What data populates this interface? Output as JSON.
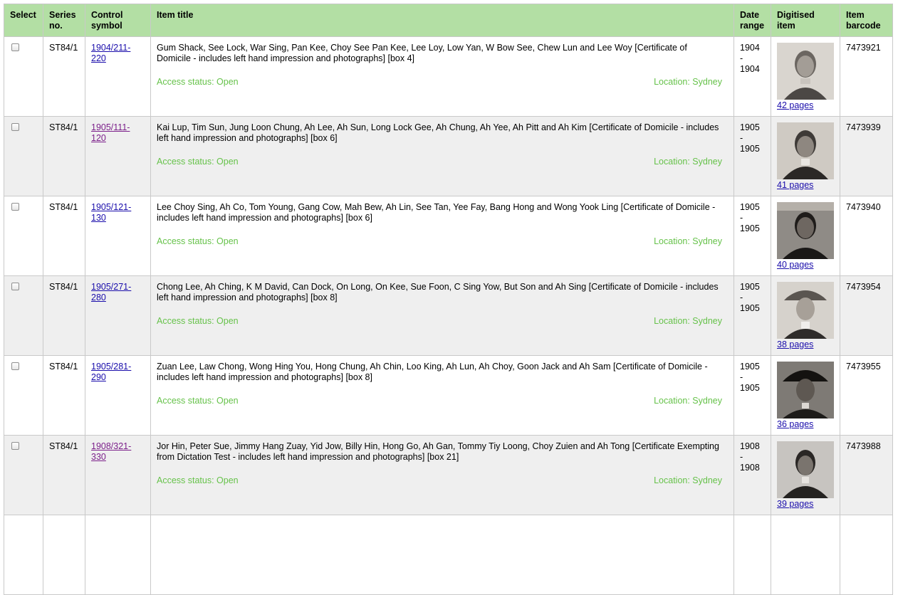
{
  "columns": {
    "select": "Select",
    "series_l1": "Series",
    "series_l2": "no.",
    "control_l1": "Control",
    "control_l2": "symbol",
    "title": "Item title",
    "date_l1": "Date",
    "date_l2": "range",
    "digitised_l1": "Digitised",
    "digitised_l2": "item",
    "barcode_l1": "Item",
    "barcode_l2": "barcode"
  },
  "rows": [
    {
      "series": "ST84/1",
      "control_l1": "1904/211-",
      "control_l2": "220",
      "title": "Gum Shack, See Lock, War Sing, Pan Kee, Choy See Pan Kee, Lee Loy, Low Yan, W Bow See, Chew Lun and Lee Woy [Certificate of Domicile - includes left hand impression and photographs] [box 4]",
      "access": "Access status: Open",
      "location": "Location: Sydney",
      "date_from": "1904",
      "date_sep": "-",
      "date_to": "1904",
      "pages": "42 pages",
      "barcode": "7473921"
    },
    {
      "series": "ST84/1",
      "control_l1": "1905/111-",
      "control_l2": "120",
      "title": "Kai Lup, Tim Sun, Jung Loon Chung, Ah Lee, Ah Sun, Long Lock Gee, Ah Chung, Ah Yee, Ah Pitt and Ah Kim [Certificate of Domicile - includes left hand impression and photographs] [box 6]",
      "access": "Access status: Open",
      "location": "Location: Sydney",
      "date_from": "1905",
      "date_sep": "-",
      "date_to": "1905",
      "pages": "41 pages",
      "barcode": "7473939"
    },
    {
      "series": "ST84/1",
      "control_l1": "1905/121-",
      "control_l2": "130",
      "title": "Lee Choy Sing, Ah Co, Tom Young, Gang Cow, Mah Bew, Ah Lin, See Tan, Yee Fay, Bang Hong and Wong Yook Ling [Certificate of Domicile - includes left hand impression and photographs] [box 6]",
      "access": "Access status: Open",
      "location": "Location: Sydney",
      "date_from": "1905",
      "date_sep": "-",
      "date_to": "1905",
      "pages": "40 pages",
      "barcode": "7473940"
    },
    {
      "series": "ST84/1",
      "control_l1": "1905/271-",
      "control_l2": "280",
      "title": "Chong Lee, Ah Ching, K M David, Can Dock, On Long, On Kee, Sue Foon, C Sing Yow, But Son and Ah Sing [Certificate of Domicile - includes left hand impression and photographs] [box 8]",
      "access": "Access status: Open",
      "location": "Location: Sydney",
      "date_from": "1905",
      "date_sep": "-",
      "date_to": "1905",
      "pages": "38 pages",
      "barcode": "7473954"
    },
    {
      "series": "ST84/1",
      "control_l1": "1905/281-",
      "control_l2": "290",
      "title": "Zuan Lee, Law Chong, Wong Hing You, Hong Chung, Ah Chin, Loo King, Ah Lun, Ah Choy, Goon Jack and Ah Sam [Certificate of Domicile - includes left hand impression and photographs] [box 8]",
      "access": "Access status: Open",
      "location": "Location: Sydney",
      "date_from": "1905",
      "date_sep": "-",
      "date_to": "1905",
      "pages": "36 pages",
      "barcode": "7473955"
    },
    {
      "series": "ST84/1",
      "control_l1": "1908/321-",
      "control_l2": "330",
      "title": "Jor Hin, Peter Sue, Jimmy Hang Zuay, Yid Jow, Billy Hin, Hong Go, Ah Gan, Tommy Tiy Loong, Choy Zuien and Ah Tong [Certificate Exempting from Dictation Test - includes left hand impression and photographs] [box 21]",
      "access": "Access status: Open",
      "location": "Location: Sydney",
      "date_from": "1908",
      "date_sep": "-",
      "date_to": "1908",
      "pages": "39 pages",
      "barcode": "7473988"
    }
  ],
  "colors": {
    "header_bg": "#b3dfa4",
    "row_alt_bg": "#efefef",
    "status_green": "#66c24a",
    "link": "#1a0dab",
    "link_visited": "#7b1f8a"
  }
}
